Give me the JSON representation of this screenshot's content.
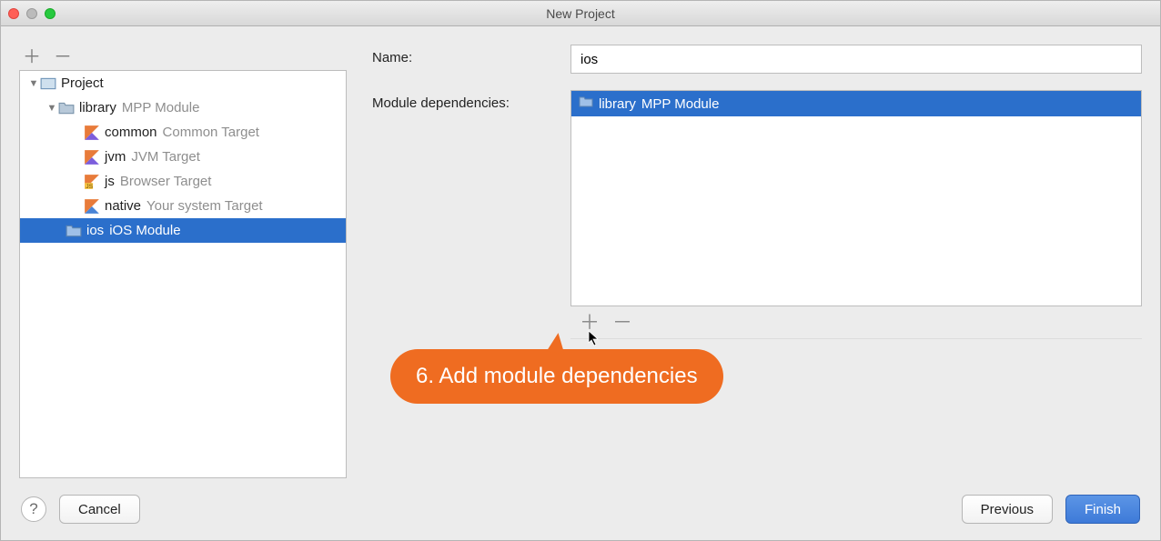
{
  "window": {
    "title": "New Project"
  },
  "form": {
    "name_label": "Name:",
    "name_value": "ios",
    "deps_label": "Module dependencies:"
  },
  "tree": {
    "root": {
      "label": "Project"
    },
    "library": {
      "name": "library",
      "type": "MPP Module"
    },
    "targets": [
      {
        "name": "common",
        "desc": "Common Target",
        "icon": "kotlin"
      },
      {
        "name": "jvm",
        "desc": "JVM Target",
        "icon": "kotlin"
      },
      {
        "name": "js",
        "desc": "Browser Target",
        "icon": "kotlin-js"
      },
      {
        "name": "native",
        "desc": "Your system Target",
        "icon": "kotlin-native"
      }
    ],
    "selected": {
      "name": "ios",
      "type": "iOS Module"
    }
  },
  "dependencies": {
    "items": [
      {
        "name": "library",
        "type": "MPP Module"
      }
    ]
  },
  "callout": {
    "text": "6. Add module dependencies"
  },
  "footer": {
    "help": "?",
    "cancel": "Cancel",
    "previous": "Previous",
    "finish": "Finish"
  }
}
